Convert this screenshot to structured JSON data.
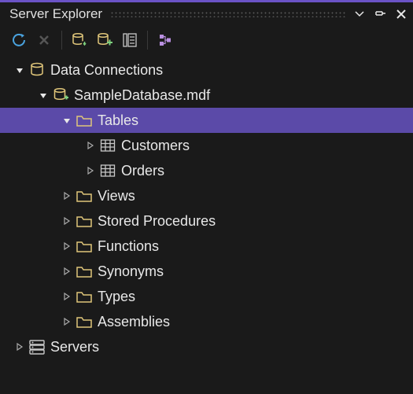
{
  "panel": {
    "title": "Server Explorer"
  },
  "tree": {
    "data_connections": {
      "label": "Data Connections",
      "database": {
        "label": "SampleDatabase.mdf",
        "folders": {
          "tables": {
            "label": "Tables",
            "items": [
              "Customers",
              "Orders"
            ]
          },
          "views": {
            "label": "Views"
          },
          "stored_procedures": {
            "label": "Stored Procedures"
          },
          "functions": {
            "label": "Functions"
          },
          "synonyms": {
            "label": "Synonyms"
          },
          "types": {
            "label": "Types"
          },
          "assemblies": {
            "label": "Assemblies"
          }
        }
      }
    },
    "servers": {
      "label": "Servers"
    }
  }
}
